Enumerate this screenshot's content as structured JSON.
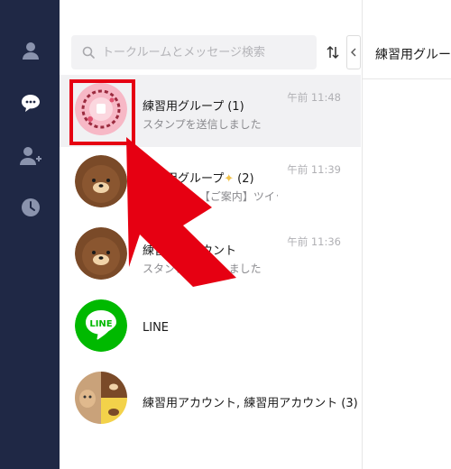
{
  "sidebar": {
    "items": [
      {
        "icon": "person-icon",
        "label": "friends"
      },
      {
        "icon": "chat-bubble-icon",
        "label": "chats"
      },
      {
        "icon": "add-friend-icon",
        "label": "add friends"
      },
      {
        "icon": "clock-icon",
        "label": "history"
      }
    ]
  },
  "search": {
    "placeholder": "トークルームとメッセージ検索"
  },
  "chats": [
    {
      "name": "練習用グループ",
      "count": "(1)",
      "preview": "スタンプを送信しました",
      "time": "午前 11:48",
      "avatar": "stamp-avatar"
    },
    {
      "name": "練習用グループ",
      "count": "(2)",
      "preview": "Channel ▸ 【ご案内】ツイッターや…",
      "time": "午前 11:39",
      "avatar": "brown-bear-avatar"
    },
    {
      "name": "練習用アカウント",
      "count": "",
      "preview": "スタンプを送信しました",
      "time": "午前 11:36",
      "avatar": "brown-bear-avatar"
    },
    {
      "name": "LINE",
      "count": "",
      "preview": "",
      "time": "",
      "avatar": "line-logo-avatar"
    },
    {
      "name": "練習用アカウント, 練習用アカウント",
      "count": "(3)",
      "preview": "",
      "time": "",
      "avatar": "group-collage-avatar"
    }
  ],
  "chat_header": {
    "title": "練習用グループ"
  },
  "colors": {
    "sidebar_bg": "#1f2845",
    "highlight": "#e60012",
    "line_green": "#00b900"
  }
}
